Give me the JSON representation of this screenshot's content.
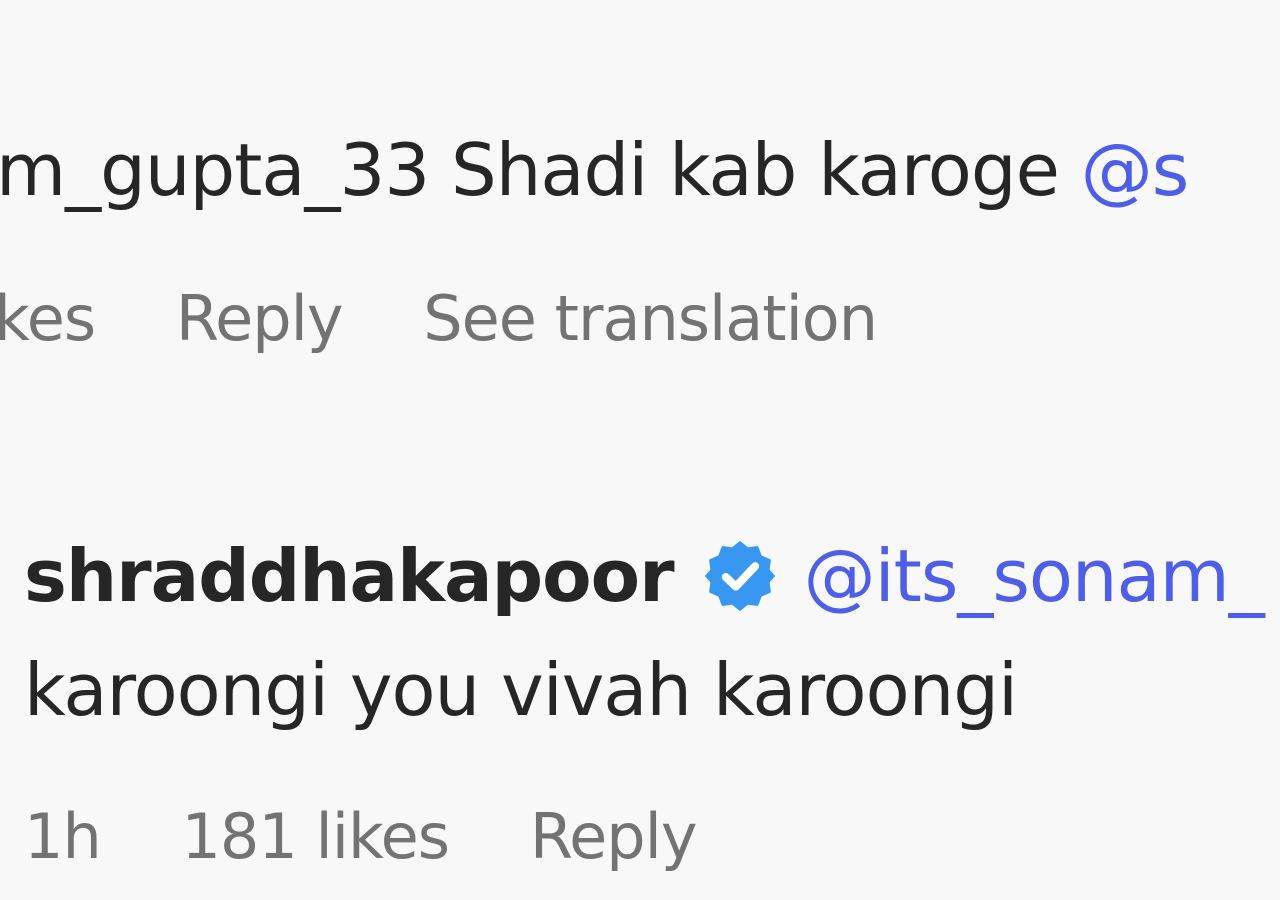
{
  "comment_1": {
    "username": "m_gupta_33",
    "text": "Shadi kab karoge",
    "mention": "@s",
    "likes_fragment": "kes",
    "reply_label": "Reply",
    "translate_label": "See translation"
  },
  "comment_2": {
    "username": "shraddhakapoor",
    "verified_icon": "verified-badge-icon",
    "mention": "@its_sonam_",
    "text": "karoongi you vivah karoongi",
    "time": "1h",
    "likes": "181 likes",
    "reply_label": "Reply"
  },
  "colors": {
    "text": "#262626",
    "secondary": "#737373",
    "mention": "#4e5ee6",
    "verified": "#3897f0",
    "background": "#f8f8f8"
  }
}
